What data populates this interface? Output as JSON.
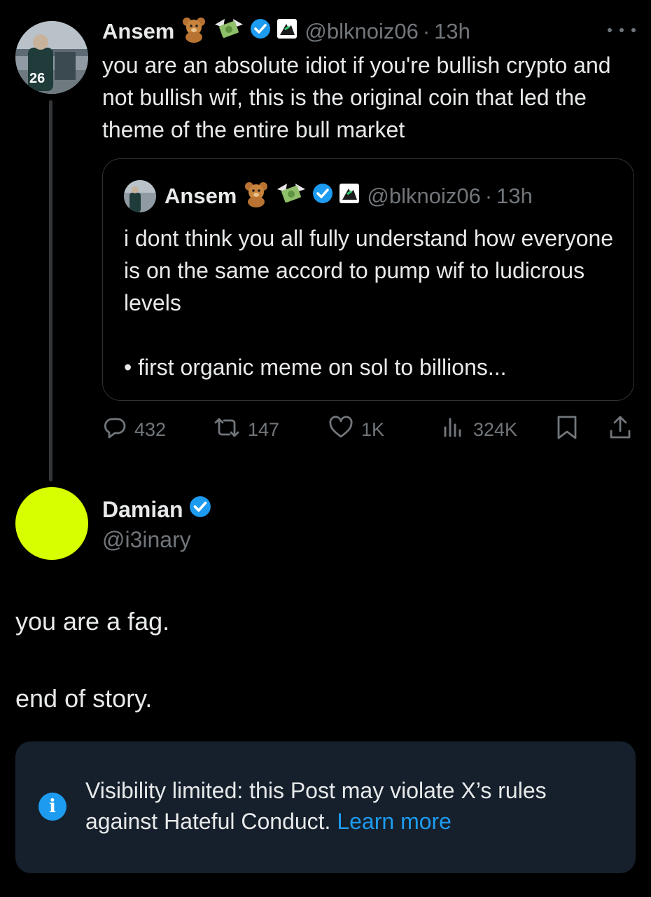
{
  "tweet": {
    "name": "Ansem",
    "handle": "@blknoiz06",
    "time": "13h",
    "text": "you are an absolute idiot if you're bullish crypto and not bullish wif, this is the original coin that led the theme of the entire bull market",
    "avatar_number": "26"
  },
  "quote": {
    "name": "Ansem",
    "handle": "@blknoiz06",
    "time": "13h",
    "text": "i dont think you all fully understand how everyone is on the same accord to pump wif to ludicrous levels\n\n• first organic meme on sol to billions..."
  },
  "actions": {
    "replies": "432",
    "reposts": "147",
    "likes": "1K",
    "views": "324K"
  },
  "reply": {
    "name": "Damian",
    "handle": "@i3inary",
    "text_line1": "you are a fag.",
    "text_line2": "end of story.",
    "avatar_color": "#d8ff00"
  },
  "notice": {
    "text": "Visibility limited: this Post may violate X’s rules against Hateful Conduct.",
    "link": "Learn more"
  },
  "colors": {
    "background": "#000000",
    "text": "#e7e9ea",
    "muted": "#71767b",
    "accent": "#1d9bf0",
    "notice_bg": "#16202c"
  },
  "icons": [
    "bear-emoji",
    "money-wings-emoji",
    "verified-badge-icon",
    "affiliate-badge-icon",
    "more-icon",
    "reply-icon",
    "repost-icon",
    "like-icon",
    "views-icon",
    "bookmark-icon",
    "share-icon",
    "info-icon"
  ]
}
